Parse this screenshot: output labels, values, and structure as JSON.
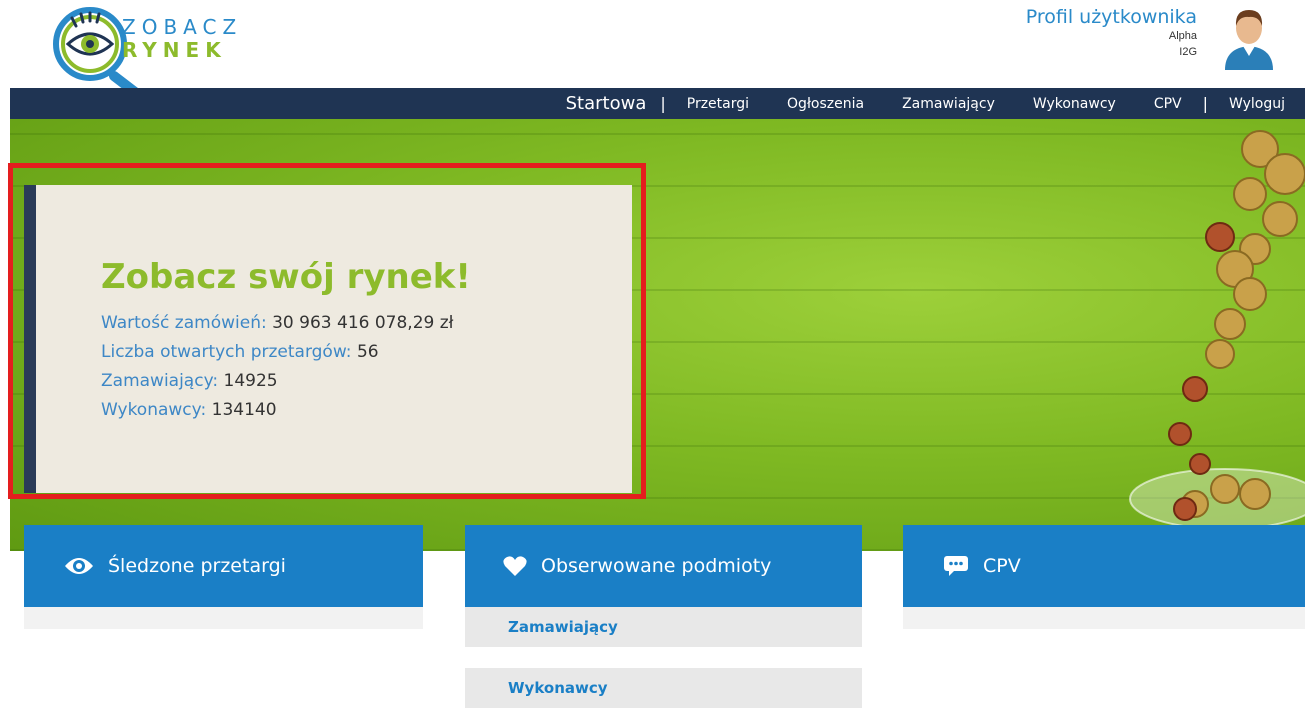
{
  "logo": {
    "line1": "ZOBACZ",
    "line2": "RYNEK"
  },
  "profile": {
    "title": "Profil użytkownika",
    "name": "Alpha",
    "org": "I2G"
  },
  "nav": {
    "home": "Startowa",
    "items": [
      "Przetargi",
      "Ogłoszenia",
      "Zamawiający",
      "Wykonawcy",
      "CPV"
    ],
    "logout": "Wyloguj"
  },
  "hero": {
    "title": "Zobacz swój rynek!",
    "stats": [
      {
        "label": "Wartość zamówień:",
        "value": "30 963 416 078,29 zł"
      },
      {
        "label": "Liczba otwartych przetargów:",
        "value": "56"
      },
      {
        "label": "Zamawiający:",
        "value": "14925"
      },
      {
        "label": "Wykonawcy:",
        "value": "134140"
      }
    ]
  },
  "tiles": [
    {
      "label": "Śledzone przetargi",
      "icon": "eye-icon"
    },
    {
      "label": "Obserwowane podmioty",
      "icon": "heart-icon",
      "submenu": [
        "Zamawiający",
        "Wykonawcy"
      ]
    },
    {
      "label": "CPV",
      "icon": "chat-icon"
    }
  ],
  "colors": {
    "navy": "#1f3453",
    "blue": "#1a7fc6",
    "green": "#8dbb2c",
    "highlight": "#e41e1e"
  }
}
